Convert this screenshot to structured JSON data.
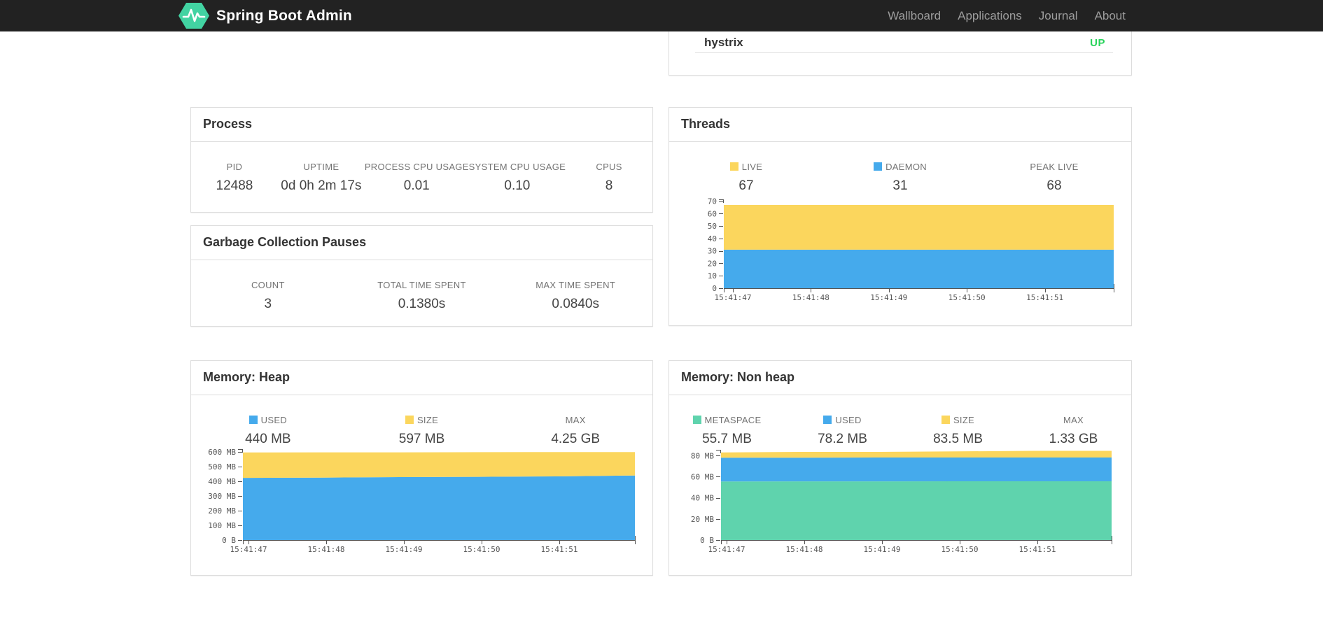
{
  "navbar": {
    "brand": "Spring Boot Admin",
    "brand_color": "#42d3a2",
    "items": [
      {
        "label": "Wallboard"
      },
      {
        "label": "Applications"
      },
      {
        "label": "Journal"
      },
      {
        "label": "About"
      }
    ]
  },
  "status_card": {
    "service": "hystrix",
    "status": "UP",
    "status_color": "#27d35a"
  },
  "process": {
    "title": "Process",
    "stats": [
      {
        "label": "PID",
        "value": "12488"
      },
      {
        "label": "UPTIME",
        "value": "0d 0h 2m 17s"
      },
      {
        "label": "PROCESS CPU USAGE",
        "value": "0.01"
      },
      {
        "label": "SYSTEM CPU USAGE",
        "value": "0.10"
      },
      {
        "label": "CPUS",
        "value": "8"
      }
    ]
  },
  "gc": {
    "title": "Garbage Collection Pauses",
    "stats": [
      {
        "label": "COUNT",
        "value": "3"
      },
      {
        "label": "TOTAL TIME SPENT",
        "value": "0.1380s"
      },
      {
        "label": "MAX TIME SPENT",
        "value": "0.0840s"
      }
    ]
  },
  "threads": {
    "title": "Threads",
    "stats": [
      {
        "label": "LIVE",
        "value": "67",
        "swatch": "#fbd65d"
      },
      {
        "label": "DAEMON",
        "value": "31",
        "swatch": "#45aaec"
      },
      {
        "label": "PEAK LIVE",
        "value": "68"
      }
    ]
  },
  "heap": {
    "title": "Memory: Heap",
    "stats": [
      {
        "label": "USED",
        "value": "440 MB",
        "swatch": "#45aaec"
      },
      {
        "label": "SIZE",
        "value": "597 MB",
        "swatch": "#fbd65d"
      },
      {
        "label": "MAX",
        "value": "4.25 GB"
      }
    ]
  },
  "nonheap": {
    "title": "Memory: Non heap",
    "stats": [
      {
        "label": "METASPACE",
        "value": "55.7 MB",
        "swatch": "#5fd3ad"
      },
      {
        "label": "USED",
        "value": "78.2 MB",
        "swatch": "#45aaec"
      },
      {
        "label": "SIZE",
        "value": "83.5 MB",
        "swatch": "#fbd65d"
      },
      {
        "label": "MAX",
        "value": "1.33 GB"
      }
    ]
  },
  "chart_data": [
    {
      "id": "threads",
      "type": "area",
      "title": "Threads",
      "stacking": "layered-absolute",
      "unit": "threads",
      "x_ticks": [
        "15:41:47",
        "15:41:48",
        "15:41:49",
        "15:41:50",
        "15:41:51"
      ],
      "ylim": [
        0,
        71.5
      ],
      "grid": false,
      "legend_position": "top",
      "y_ticks": [
        {
          "v": 0,
          "label": "0"
        },
        {
          "v": 10,
          "label": "10"
        },
        {
          "v": 20,
          "label": "20"
        },
        {
          "v": 30,
          "label": "30"
        },
        {
          "v": 40,
          "label": "40"
        },
        {
          "v": 50,
          "label": "50"
        },
        {
          "v": 60,
          "label": "60"
        },
        {
          "v": 70,
          "label": "70"
        }
      ],
      "series": [
        {
          "name": "DAEMON",
          "color": "#45aaec",
          "values": [
            31,
            31,
            31,
            31,
            31,
            31
          ]
        },
        {
          "name": "LIVE",
          "color": "#fbd65d",
          "values": [
            67,
            67,
            67,
            67,
            67,
            67
          ]
        }
      ]
    },
    {
      "id": "heap",
      "type": "area",
      "title": "Memory: Heap",
      "stacking": "layered-absolute",
      "unit": "MB",
      "x_ticks": [
        "15:41:47",
        "15:41:48",
        "15:41:49",
        "15:41:50",
        "15:41:51"
      ],
      "ylim": [
        0,
        620
      ],
      "grid": false,
      "legend_position": "top",
      "y_ticks": [
        {
          "v": 0,
          "label": "0 B"
        },
        {
          "v": 100,
          "label": "100 MB"
        },
        {
          "v": 200,
          "label": "200 MB"
        },
        {
          "v": 300,
          "label": "300 MB"
        },
        {
          "v": 400,
          "label": "400 MB"
        },
        {
          "v": 500,
          "label": "500 MB"
        },
        {
          "v": 600,
          "label": "600 MB"
        }
      ],
      "series": [
        {
          "name": "USED",
          "color": "#45aaec",
          "values": [
            424,
            426,
            429,
            431,
            434,
            440
          ]
        },
        {
          "name": "SIZE",
          "color": "#fbd65d",
          "values": [
            597,
            598,
            598,
            599,
            600,
            600
          ]
        }
      ]
    },
    {
      "id": "nonheap",
      "type": "area",
      "title": "Memory: Non heap",
      "stacking": "layered-absolute",
      "unit": "MB",
      "x_ticks": [
        "15:41:47",
        "15:41:48",
        "15:41:49",
        "15:41:50",
        "15:41:51"
      ],
      "ylim": [
        0,
        85.5
      ],
      "grid": false,
      "legend_position": "top",
      "y_ticks": [
        {
          "v": 0,
          "label": "0 B"
        },
        {
          "v": 20,
          "label": "20 MB"
        },
        {
          "v": 40,
          "label": "40 MB"
        },
        {
          "v": 60,
          "label": "60 MB"
        },
        {
          "v": 80,
          "label": "80 MB"
        }
      ],
      "series": [
        {
          "name": "METASPACE",
          "color": "#5fd3ad",
          "values": [
            55.5,
            55.6,
            55.6,
            55.7,
            55.7,
            55.7
          ]
        },
        {
          "name": "USED",
          "color": "#45aaec",
          "values": [
            78,
            78,
            78.2,
            78.2,
            78.2,
            78.2
          ]
        },
        {
          "name": "SIZE",
          "color": "#fbd65d",
          "values": [
            83,
            83.5,
            83.5,
            84,
            84.5,
            84.5
          ]
        }
      ]
    }
  ]
}
